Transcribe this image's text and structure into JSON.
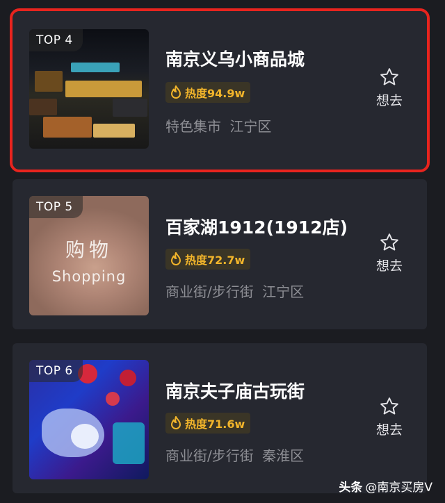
{
  "items": [
    {
      "rank": "TOP 4",
      "title": "南京义乌小商品城",
      "heat": "热度94.9w",
      "category": "特色集市",
      "district": "江宁区",
      "fav_label": "想去",
      "thumbnail": "night-market-photo"
    },
    {
      "rank": "TOP 5",
      "title": "百家湖1912(1912店)",
      "heat": "热度72.7w",
      "category": "商业街/步行街",
      "district": "江宁区",
      "fav_label": "想去",
      "thumbnail": "shopping-placeholder",
      "thumb_text_cn": "购物",
      "thumb_text_en": "Shopping"
    },
    {
      "rank": "TOP 6",
      "title": "南京夫子庙古玩街",
      "heat": "热度71.6w",
      "category": "商业街/步行街",
      "district": "秦淮区",
      "fav_label": "想去",
      "thumbnail": "lantern-festival-photo"
    }
  ],
  "watermark": {
    "brand": "头条",
    "handle": "@南京买房V"
  },
  "colors": {
    "highlight_border": "#e8241e",
    "heat_text": "#f2b52b",
    "card_bg": "#262830"
  }
}
